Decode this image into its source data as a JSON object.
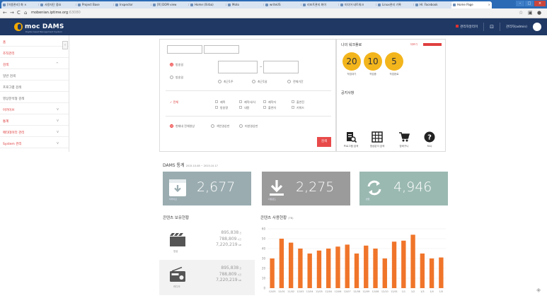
{
  "browser": {
    "tabs": [
      {
        "label": "[이용관리] 화 ×"
      },
      {
        "label": "사용자단 중요"
      },
      {
        "label": "Project Base"
      },
      {
        "label": "Inspector"
      },
      {
        "label": "[R] DOM view"
      },
      {
        "label": "Home (Xirba)"
      },
      {
        "label": "Moto"
      },
      {
        "label": "writeUS"
      },
      {
        "label": "리포트관리 화이"
      },
      {
        "label": "미디어 네트워크"
      },
      {
        "label": "Linux관리 기록"
      },
      {
        "label": "Hi: Facebook"
      },
      {
        "label": "Home Page"
      }
    ],
    "url_host": "mobenian.iptime.org",
    "url_port": ":63080"
  },
  "header": {
    "logo_text": "moc DAMS",
    "logo_sub": "Digital Asset Management System",
    "notice_label": "관리자알리미",
    "user_label": "관리자(admin)"
  },
  "sidebar": {
    "collapse_glyph": "‹",
    "items": [
      {
        "label": "홈"
      },
      {
        "label": "조직관리"
      },
      {
        "label": "검색",
        "chevron": "^"
      },
      {
        "label": "일반 검색"
      },
      {
        "label": "프로그램 검색"
      },
      {
        "label": "영상분석형 검색"
      },
      {
        "label": "아카이브",
        "chevron": "v"
      },
      {
        "label": "통계",
        "chevron": "v"
      },
      {
        "label": "메타데이터 관리",
        "chevron": "v"
      },
      {
        "label": "System 관리",
        "chevron": "v"
      }
    ]
  },
  "search": {
    "date_radio_1": "방송일",
    "date_radio_2": "방송일",
    "range_1": "최근1주",
    "range_2": "최근1달",
    "range_3": "전체기간",
    "cat_all": "전체",
    "cat_items": [
      "제목",
      "방송명",
      "제작사/사",
      "내용",
      "제작자",
      "출연자",
      "출연진",
      "키워드"
    ],
    "scope_1": "현재내 전체영상",
    "scope_2": "색인영상만",
    "scope_3": "미방영상만",
    "submit_label": "검색"
  },
  "right_panel": {
    "title": "나의 워크플로",
    "more_label": "더보기",
    "stats": [
      {
        "value": "20",
        "label": "작업대기"
      },
      {
        "value": "10",
        "label": "작업중"
      },
      {
        "value": "5",
        "label": "작업완료"
      }
    ],
    "notice_title": "공지사항",
    "quick_links": [
      {
        "label": "프로그램 검색",
        "icon": "search-doc-icon"
      },
      {
        "label": "영상분석 검색",
        "icon": "grid-table-icon"
      },
      {
        "label": "장바구니",
        "icon": "cart-icon"
      },
      {
        "label": "FAQ",
        "icon": "question-icon"
      }
    ]
  },
  "stats": {
    "title": "DAMS 통계",
    "period": "2015.10.08 ~ 2015.10.17",
    "boxes": [
      {
        "value": "2,677",
        "caption": "아카이브",
        "color": "#9aacb0",
        "icon": "archive-icon"
      },
      {
        "value": "2,275",
        "caption": "다운로드",
        "color": "#9b9b9b",
        "icon": "download-icon"
      },
      {
        "value": "4,946",
        "caption": "변환",
        "color": "#9ab9b1",
        "icon": "refresh-icon"
      }
    ]
  },
  "holdings": {
    "title": "콘텐츠 보유현황",
    "rows": [
      {
        "caption": "영상",
        "icon": "film-icon",
        "v1": "895,838",
        "u1": "건",
        "v2": "788,809",
        "u2": "시간",
        "v3": "7,220,219",
        "u3": "GB"
      },
      {
        "caption": "라디오",
        "icon": "radio-icon",
        "v1": "895,838",
        "u1": "건",
        "v2": "788,809",
        "u2": "시간",
        "v3": "7,220,219",
        "u3": "GB"
      }
    ]
  },
  "chart_data": {
    "type": "bar",
    "title": "콘텐츠 사용현황",
    "subtitle": "(TB)",
    "ylim": [
      0,
      60
    ],
    "yticks": [
      0,
      10,
      20,
      30,
      40,
      50,
      60
    ],
    "categories": [
      "12/05",
      "12/01",
      "11/02",
      "12/03",
      "12/04",
      "12/05",
      "12/04",
      "12/06",
      "12/07",
      "12/08",
      "12/09",
      "12/08",
      "12/10",
      "12/01",
      "1/1",
      "1/2",
      "1/3",
      "1/4",
      "1/5"
    ],
    "values": [
      30,
      50,
      46,
      40,
      35,
      38,
      40,
      42,
      44,
      35,
      43,
      40,
      30,
      47,
      48,
      54,
      35,
      30,
      31
    ],
    "color": "#f0752a"
  }
}
